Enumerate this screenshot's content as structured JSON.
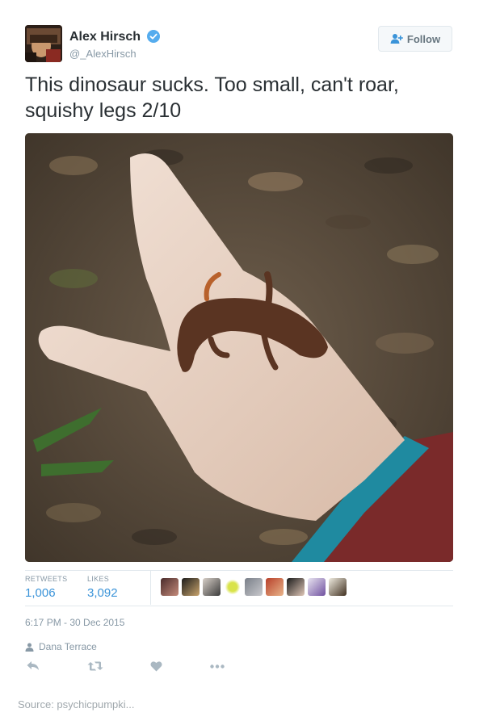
{
  "author": {
    "name": "Alex Hirsch",
    "handle": "@_AlexHirsch",
    "verified": true,
    "avatar_icon": "avatar-photo"
  },
  "follow_button": {
    "label": "Follow",
    "icon": "add-user-icon"
  },
  "tweet": {
    "text": "This dinosaur sucks. Too small, can't roar, squishy legs 2/10",
    "photo_description_icon": "newt-on-hand-photo"
  },
  "stats": {
    "retweets_label": "RETWEETS",
    "retweets_value": "1,006",
    "likes_label": "LIKES",
    "likes_value": "3,092"
  },
  "likers_count": 9,
  "timestamp": "6:17 PM - 30 Dec 2015",
  "retweeted_by": {
    "name": "Dana Terrace",
    "icon": "person-icon"
  },
  "actions": [
    {
      "name": "reply-icon"
    },
    {
      "name": "retweet-icon"
    },
    {
      "name": "like-icon"
    },
    {
      "name": "more-icon"
    }
  ],
  "source": "Source: psychicpumpki...",
  "colors": {
    "link": "#3b94d9",
    "muted": "#8899a6",
    "text": "#292f33",
    "verified": "#55acee",
    "action_icon": "#aab8c2"
  }
}
